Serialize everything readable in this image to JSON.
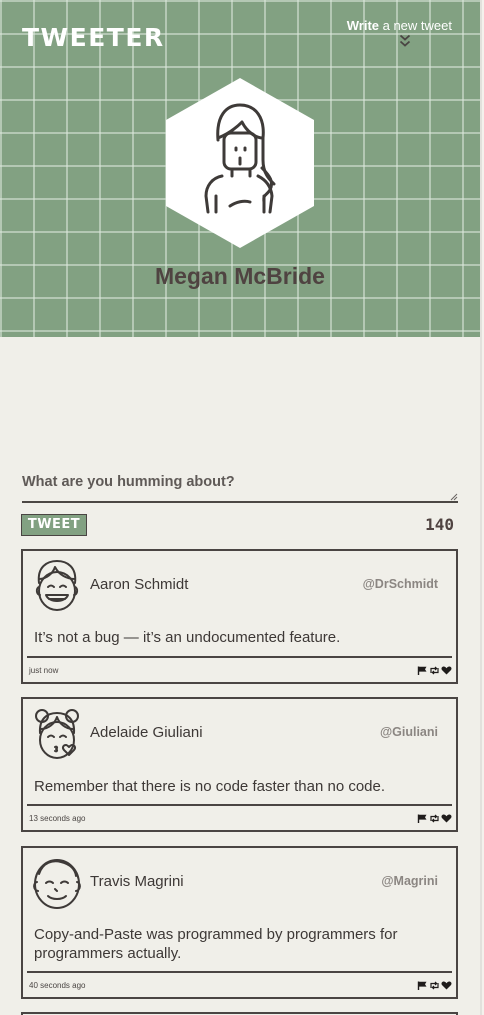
{
  "header": {
    "logo": "TWEETER",
    "write_bold": "Write",
    "write_rest": " a new tweet",
    "profile_name": "Megan McBride"
  },
  "composer": {
    "placeholder": "What are you humming about?",
    "button_label": "TWEET",
    "counter": "140"
  },
  "tweets": [
    {
      "name": "Aaron Schmidt",
      "handle": "@DrSchmidt",
      "text": "It’s not a bug — it’s an undocumented feature.",
      "time": "just now"
    },
    {
      "name": "Adelaide Giuliani",
      "handle": "@Giuliani",
      "text": "Remember that there is no code faster than no code.",
      "time": "13 seconds ago"
    },
    {
      "name": "Travis Magrini",
      "handle": "@Magrini",
      "text": "Copy-and-Paste was programmed by programmers for programmers actually.",
      "time": "40 seconds ago"
    }
  ],
  "colors": {
    "accent": "#82a182",
    "ink": "#4a4543",
    "background": "#f0efe9"
  },
  "icons": {
    "chevrons": "double-chevron-down-icon",
    "flag": "flag-icon",
    "retweet": "retweet-icon",
    "like": "heart-icon"
  }
}
